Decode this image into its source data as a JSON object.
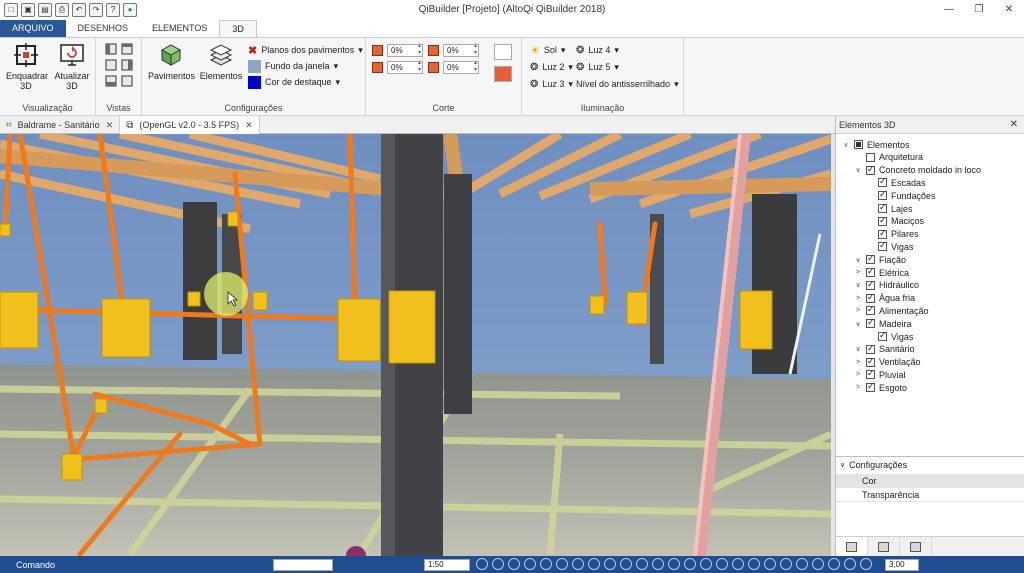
{
  "window": {
    "title": "QiBuilder [Projeto] (AltoQi QiBuilder 2018)",
    "controls": [
      "—",
      "❐",
      "✕"
    ]
  },
  "quick_access": {
    "icons": [
      "new-icon",
      "open-icon",
      "save-icon",
      "print-icon",
      "undo-icon",
      "redo-icon",
      "help-icon",
      "update-icon"
    ],
    "glyphs": [
      "□",
      "▣",
      "▤",
      "⎙",
      "↶",
      "↷",
      "?",
      "●"
    ]
  },
  "ribbon_tabs": [
    {
      "label": "ARQUIVO"
    },
    {
      "label": "DESENHOS"
    },
    {
      "label": "ELEMENTOS"
    },
    {
      "label": "3D"
    }
  ],
  "ribbon": {
    "visualizacao": {
      "label": "Visualização",
      "enquadrar": "Enquadrar 3D",
      "atualizar": "Atualizar 3D"
    },
    "vistas": {
      "label": "Vistas"
    },
    "configuracoes": {
      "label": "Configurações",
      "pavimentos": "Pavimentos",
      "elementos": "Elementos",
      "planos": "Planos dos pavimentos",
      "fundo": "Fundo da janela",
      "destaque": "Cor de destaque"
    },
    "corte": {
      "label": "Corte",
      "values": [
        "0%",
        "0%",
        "0%",
        "0%"
      ]
    },
    "iluminacao": {
      "label": "Iluminação",
      "sol": "Sol",
      "luz2": "Luz 2",
      "luz3": "Luz 3",
      "luz4": "Luz 4",
      "luz5": "Luz 5",
      "antisserrilhado": "Nível do antisserrilhado"
    },
    "colors": {
      "fundo": "#8ea4c8",
      "destaque": "#0000cc"
    }
  },
  "doc_tabs": [
    {
      "label": "Baldrame - Sanitário"
    },
    {
      "label": "(OpenGL v2.0 - 3.5 FPS)"
    }
  ],
  "panel": {
    "title": "Elementos 3D",
    "tree": [
      {
        "label": "Elementos",
        "checked": "partial",
        "caret": "∨"
      },
      {
        "label": "Arquitetura",
        "checked": false,
        "caret": ""
      },
      {
        "label": "Concreto moldado in loco",
        "checked": true,
        "caret": "∨"
      },
      {
        "label": "Escadas",
        "checked": true,
        "caret": ""
      },
      {
        "label": "Fundações",
        "checked": true,
        "caret": ""
      },
      {
        "label": "Lajes",
        "checked": true,
        "caret": ""
      },
      {
        "label": "Maciços",
        "checked": true,
        "caret": ""
      },
      {
        "label": "Pilares",
        "checked": true,
        "caret": ""
      },
      {
        "label": "Vigas",
        "checked": true,
        "caret": ""
      },
      {
        "label": "Fiação",
        "checked": true,
        "caret": "∨"
      },
      {
        "label": "Elétrica",
        "checked": true,
        "caret": ">"
      },
      {
        "label": "Hidráulico",
        "checked": true,
        "caret": "∨"
      },
      {
        "label": "Água fria",
        "checked": true,
        "caret": ">"
      },
      {
        "label": "Alimentação",
        "checked": true,
        "caret": ">"
      },
      {
        "label": "Madeira",
        "checked": true,
        "caret": "∨"
      },
      {
        "label": "Vigas",
        "checked": true,
        "caret": ""
      },
      {
        "label": "Sanitário",
        "checked": true,
        "caret": "∨"
      },
      {
        "label": "Ventilação",
        "checked": true,
        "caret": ">"
      },
      {
        "label": "Pluvial",
        "checked": true,
        "caret": ">"
      },
      {
        "label": "Esgoto",
        "checked": true,
        "caret": ">"
      }
    ],
    "config": {
      "title": "Configurações",
      "rows": [
        "Cor",
        "Transparência"
      ]
    }
  },
  "statusbar": {
    "command_label": "Comando",
    "scale": "1:50",
    "zoom": "3,00"
  }
}
